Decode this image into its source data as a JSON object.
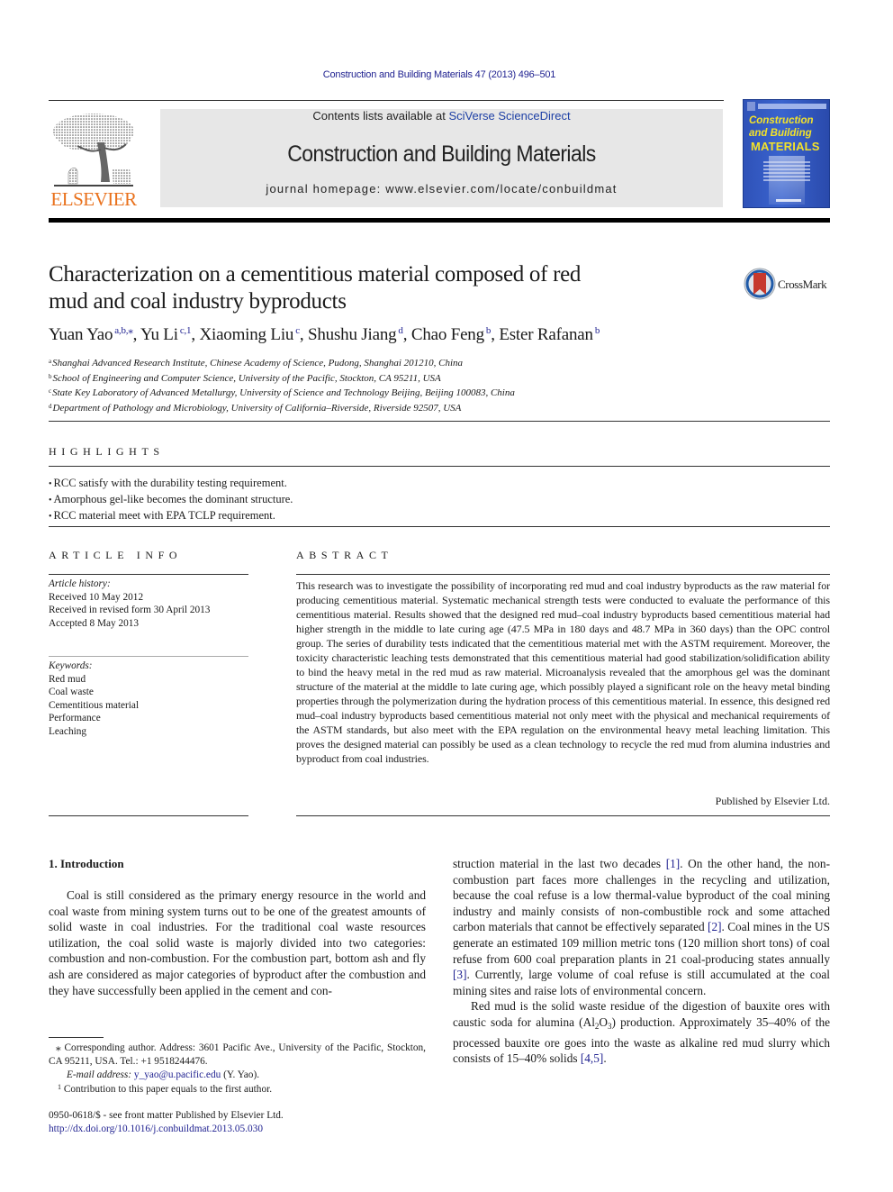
{
  "header": {
    "citation": "Construction and Building Materials 47 (2013) 496–501",
    "contents_prefix": "Contents lists available at ",
    "contents_link": "SciVerse ScienceDirect",
    "journal_name": "Construction and Building Materials",
    "homepage_prefix": "journal homepage: ",
    "homepage_url": "www.elsevier.com/locate/conbuildmat",
    "publisher_logo_text": "ELSEVIER",
    "cover": {
      "line1": "Construction",
      "line2": "and Building",
      "line3": "MATERIALS"
    },
    "colors": {
      "elsevier_orange": "#e9711c",
      "link_blue": "#1d1f8f",
      "cover_blue": "#2f52b8",
      "cover_yellow": "#f3e22a",
      "banner_gray": "#e7e7e7"
    }
  },
  "article": {
    "title_line1": "Characterization on a cementitious material composed of red",
    "title_line2": "mud and coal industry byproducts",
    "crossmark_label": "CrossMark",
    "authors": [
      {
        "name": "Yuan Yao",
        "sup": "a,b,⁎"
      },
      {
        "name": "Yu Li",
        "sup": "c,1"
      },
      {
        "name": "Xiaoming Liu",
        "sup": "c"
      },
      {
        "name": "Shushu Jiang",
        "sup": "d"
      },
      {
        "name": "Chao Feng",
        "sup": "b"
      },
      {
        "name": "Ester Rafanan",
        "sup": "b"
      }
    ],
    "affiliations": [
      {
        "key": "a",
        "text": "Shanghai Advanced Research Institute, Chinese Academy of Science, Pudong, Shanghai 201210, China"
      },
      {
        "key": "b",
        "text": "School of Engineering and Computer Science, University of the Pacific, Stockton, CA 95211, USA"
      },
      {
        "key": "c",
        "text": "State Key Laboratory of Advanced Metallurgy, University of Science and Technology Beijing, Beijing 100083, China"
      },
      {
        "key": "d",
        "text": "Department of Pathology and Microbiology, University of California–Riverside, Riverside 92507, USA"
      }
    ]
  },
  "highlights": {
    "heading": "HIGHLIGHTS",
    "items": [
      "RCC satisfy with the durability testing requirement.",
      "Amorphous gel-like becomes the dominant structure.",
      "RCC material meet with EPA TCLP requirement."
    ]
  },
  "article_info": {
    "heading": "ARTICLE INFO",
    "history_label": "Article history:",
    "history": [
      "Received 10 May 2012",
      "Received in revised form 30 April 2013",
      "Accepted 8 May 2013"
    ],
    "keywords_label": "Keywords:",
    "keywords": [
      "Red mud",
      "Coal waste",
      "Cementitious material",
      "Performance",
      "Leaching"
    ]
  },
  "abstract": {
    "heading": "ABSTRACT",
    "text": "This research was to investigate the possibility of incorporating red mud and coal industry byproducts as the raw material for producing cementitious material. Systematic mechanical strength tests were conducted to evaluate the performance of this cementitious material. Results showed that the designed red mud–coal industry byproducts based cementitious material had higher strength in the middle to late curing age (47.5 MPa in 180 days and 48.7 MPa in 360 days) than the OPC control group. The series of durability tests indicated that the cementitious material met with the ASTM requirement. Moreover, the toxicity characteristic leaching tests demonstrated that this cementitious material had good stabilization/solidification ability to bind the heavy metal in the red mud as raw material. Microanalysis revealed that the amorphous gel was the dominant structure of the material at the middle to late curing age, which possibly played a significant role on the heavy metal binding properties through the polymerization during the hydration process of this cementitious material. In essence, this designed red mud–coal industry byproducts based cementitious material not only meet with the physical and mechanical requirements of the ASTM standards, but also meet with the EPA regulation on the environmental heavy metal leaching limitation. This proves the designed material can possibly be used as a clean technology to recycle the red mud from alumina industries and byproduct from coal industries.",
    "publisher_note": "Published by Elsevier Ltd."
  },
  "introduction": {
    "heading": "1. Introduction",
    "left_para": "Coal is still considered as the primary energy resource in the world and coal waste from mining system turns out to be one of the greatest amounts of solid waste in coal industries. For the traditional coal waste resources utilization, the coal solid waste is majorly divided into two categories: combustion and non-combustion. For the combustion part, bottom ash and fly ash are considered as major categories of byproduct after the combustion and they have successfully been applied in the cement and con-",
    "right_para1_a": "struction material in the last two decades ",
    "ref1": "[1]",
    "right_para1_b": ". On the other hand, the non-combustion part faces more challenges in the recycling and utilization, because the coal refuse is a low thermal-value byproduct of the coal mining industry and mainly consists of non-combustible rock and some attached carbon materials that cannot be effectively separated ",
    "ref2": "[2]",
    "right_para1_c": ". Coal mines in the US generate an estimated 109 million metric tons (120 million short tons) of coal refuse from 600 coal preparation plants in 21 coal-producing states annually ",
    "ref3": "[3]",
    "right_para1_d": ". Currently, large volume of coal refuse is still accumulated at the coal mining sites and raise lots of environmental concern.",
    "right_para2_a": "Red mud is the solid waste residue of the digestion of bauxite ores with caustic soda for alumina (Al",
    "al_sub": "2",
    "o_text": "O",
    "o_sub": "3",
    "right_para2_b": ") production. Approximately 35–40% of the processed bauxite ore goes into the waste as alkaline red mud slurry which consists of 15–40% solids ",
    "ref45": "[4,5]",
    "right_para2_c": "."
  },
  "footnotes": {
    "corresponding_mark": "⁎",
    "corresponding": " Corresponding author. Address: 3601 Pacific Ave., University of the Pacific, Stockton, CA 95211, USA. Tel.: +1 9518244476.",
    "email_label": "E-mail address: ",
    "email": "y_yao@u.pacific.edu",
    "email_suffix": " (Y. Yao).",
    "note1_mark": "1",
    "note1": " Contribution to this paper equals to the first author.",
    "issn_line": "0950-0618/$ - see front matter Published by Elsevier Ltd.",
    "doi": "http://dx.doi.org/10.1016/j.conbuildmat.2013.05.030"
  }
}
